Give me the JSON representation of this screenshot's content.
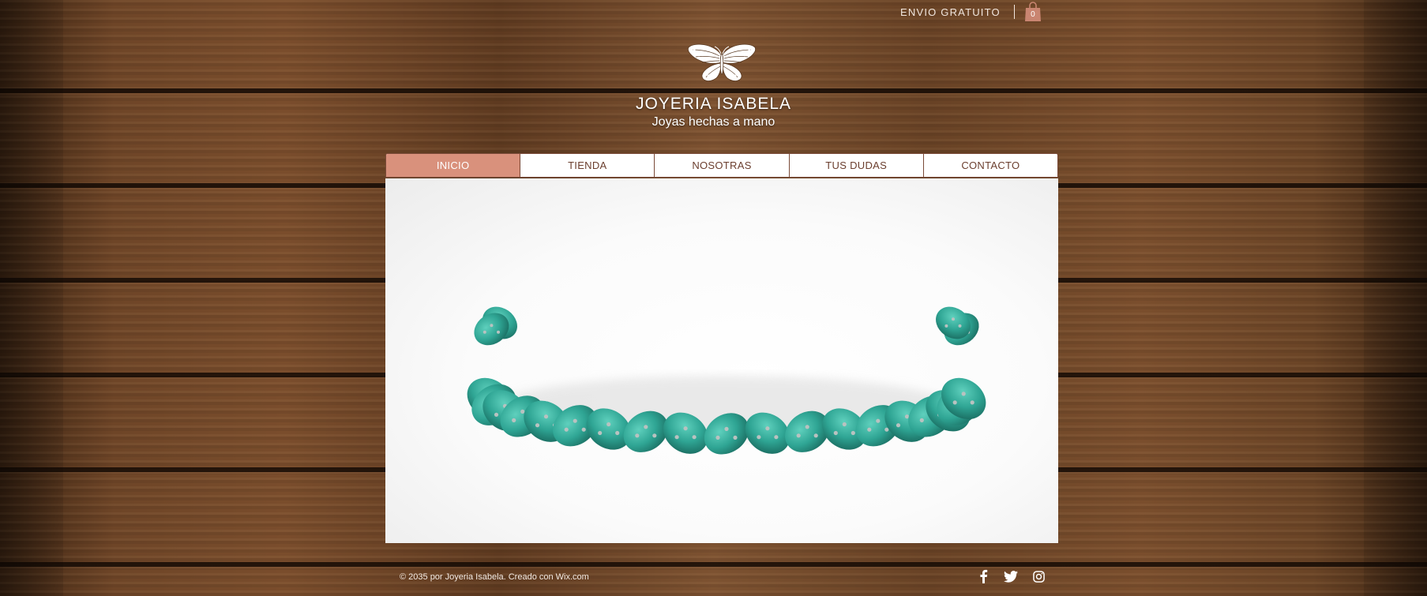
{
  "header": {
    "promo_text": "ENVIO GRATUITO",
    "cart_count": "0",
    "logo_icon": "butterfly-icon",
    "title": "JOYERIA ISABELA",
    "subtitle": "Joyas hechas a mano"
  },
  "nav": {
    "items": [
      {
        "label": "INICIO",
        "active": true
      },
      {
        "label": "TIENDA",
        "active": false
      },
      {
        "label": "NOSOTRAS",
        "active": false
      },
      {
        "label": "TUS DUDAS",
        "active": false
      },
      {
        "label": "CONTACTO",
        "active": false
      }
    ]
  },
  "hero": {
    "image_icon": "beaded-turquoise-necklace"
  },
  "footer": {
    "copyright": "© 2035 por Joyeria Isabela. Creado con Wix.com",
    "social": [
      "facebook-icon",
      "twitter-icon",
      "instagram-icon"
    ]
  },
  "colors": {
    "accent": "#d9917c",
    "nav_text": "#6b3e2e",
    "nav_border": "#7a4a38",
    "bead": "#2fa594",
    "wood": "#6a4426"
  }
}
